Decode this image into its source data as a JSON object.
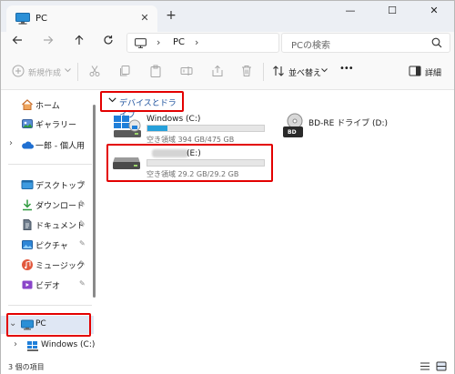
{
  "tab": {
    "title": "PC",
    "close": "✕",
    "add": "+"
  },
  "window_controls": {
    "minimize": "—",
    "maximize": "☐",
    "close": "✕"
  },
  "address": {
    "crumb": "PC",
    "sep1": "›",
    "sep2": "›"
  },
  "search": {
    "placeholder": "PCの検索"
  },
  "commands": {
    "new": "新規作成",
    "sort": "並べ替え",
    "more": "•••",
    "details": "詳細"
  },
  "sidebar": {
    "items": [
      {
        "label": "ホーム"
      },
      {
        "label": "ギャラリー"
      },
      {
        "label": "一郎 - 個人用"
      },
      {
        "label": "デスクトップ"
      },
      {
        "label": "ダウンロード"
      },
      {
        "label": "ドキュメント"
      },
      {
        "label": "ピクチャ"
      },
      {
        "label": "ミュージック"
      },
      {
        "label": "ビデオ"
      },
      {
        "label": "PC"
      },
      {
        "label": "Windows (C:)"
      }
    ],
    "pin_glyph": "📌"
  },
  "content": {
    "group_label": "デバイスとドライブ",
    "drives": [
      {
        "name": "Windows (C:)",
        "free": "空き領域 394 GB/475 GB",
        "used_fraction": 0.17
      },
      {
        "name": "BD-RE ドライブ (D:)",
        "badge": "BD"
      },
      {
        "name": "(E:)",
        "free": "空き領域 29.2 GB/29.2 GB",
        "used_fraction": 0.0
      }
    ]
  },
  "status": {
    "text": "3 個の項目"
  },
  "colors": {
    "accent": "#26a0da",
    "highlight": "#e30000",
    "selection": "#dfe7f4",
    "group": "#1a4f9c"
  }
}
